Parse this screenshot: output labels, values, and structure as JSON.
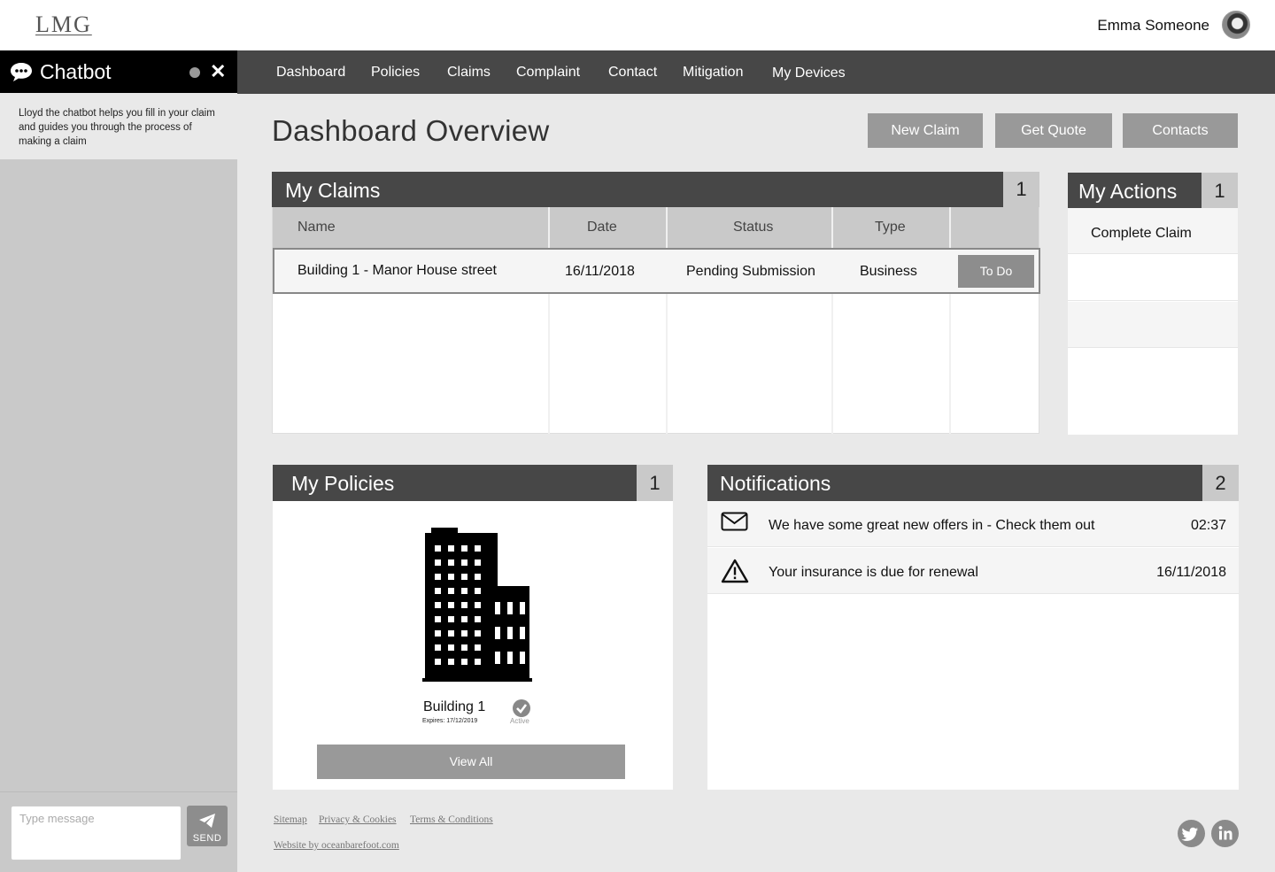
{
  "header": {
    "logo": "LMG",
    "user_name": "Emma Someone"
  },
  "chatbot": {
    "title": "Chatbot",
    "intro": "Lloyd the chatbot helps you fill in your claim and guides you through the process of making a claim",
    "input_placeholder": "Type message",
    "send_label": "SEND"
  },
  "nav": [
    "Dashboard",
    "Policies",
    "Claims",
    "Complaint",
    "Contact",
    "Mitigation",
    "My Devices"
  ],
  "page": {
    "title": "Dashboard Overview",
    "buttons": {
      "new_claim": "New Claim",
      "get_quote": "Get Quote",
      "contacts": "Contacts"
    }
  },
  "claims": {
    "title": "My Claims",
    "count": "1",
    "columns": [
      "Name",
      "Date",
      "Status",
      "Type"
    ],
    "rows": [
      {
        "name": "Building 1 - Manor House street",
        "date": "16/11/2018",
        "status": "Pending Submission",
        "type": "Business",
        "action": "To Do"
      }
    ]
  },
  "actions": {
    "title": "My Actions",
    "count": "1",
    "items": [
      "Complete Claim"
    ]
  },
  "policies": {
    "title": "My Policies",
    "count": "1",
    "item": {
      "name": "Building 1",
      "expires": "Expires: 17/12/2019",
      "status": "Active"
    },
    "view_all": "View All"
  },
  "notifications": {
    "title": "Notifications",
    "count": "2",
    "items": [
      {
        "icon": "envelope-icon",
        "text": "We have some great new offers in - Check them out",
        "time": "02:37"
      },
      {
        "icon": "warning-icon",
        "text": "Your insurance is due for renewal",
        "time": "16/11/2018"
      }
    ]
  },
  "footer": {
    "links": [
      "Sitemap",
      "Privacy & Cookies",
      "Terms & Conditions"
    ],
    "credit": "Website by oceanbarefoot.com",
    "social": [
      "twitter-icon",
      "linkedin-icon"
    ]
  },
  "colors": {
    "dark": "#474747",
    "black": "#000000",
    "grey_button": "#999999",
    "sidebar": "#c9c9c9",
    "background": "#e9e9e9"
  }
}
